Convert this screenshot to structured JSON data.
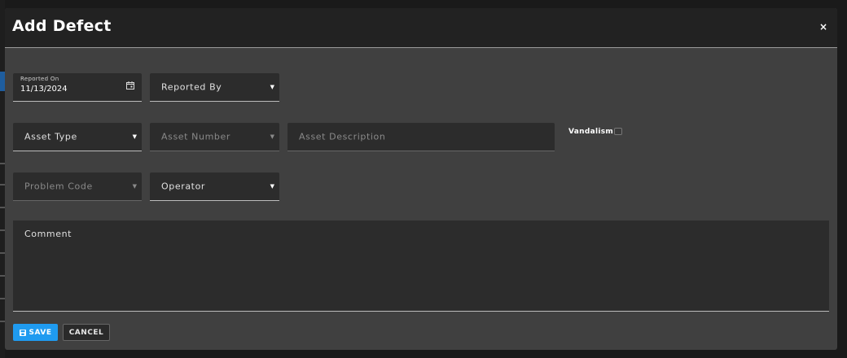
{
  "modal": {
    "title": "Add Defect",
    "close_glyph": "×"
  },
  "form": {
    "reported_on": {
      "label": "Reported On",
      "value": "11/13/2024",
      "icon": "calendar-icon"
    },
    "reported_by": {
      "label": "Reported By"
    },
    "asset_type": {
      "label": "Asset Type"
    },
    "asset_number": {
      "label": "Asset Number"
    },
    "asset_description": {
      "label": "Asset Description"
    },
    "vandalism": {
      "label": "Vandalism",
      "checked": false
    },
    "problem_code": {
      "label": "Problem Code"
    },
    "operator": {
      "label": "Operator"
    },
    "comment": {
      "label": "Comment"
    }
  },
  "buttons": {
    "save": {
      "label": "SAVE",
      "icon": "floppy-disk-icon"
    },
    "cancel": {
      "label": "CANCEL"
    }
  },
  "colors": {
    "primary": "#1f9bf0",
    "modal_bg": "#404040",
    "header_bg": "#222222",
    "field_bg": "#2c2c2c"
  }
}
